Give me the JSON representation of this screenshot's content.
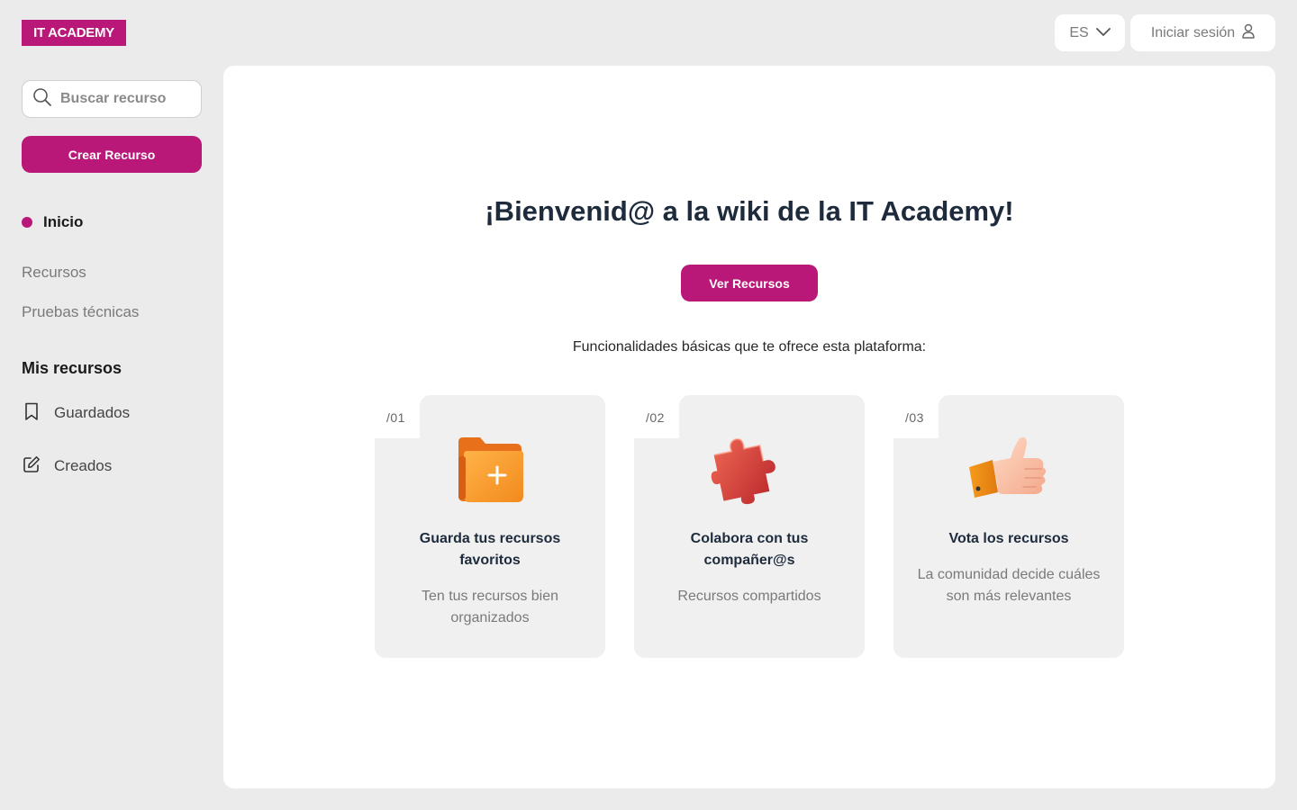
{
  "header": {
    "logo": "IT ACADEMY",
    "language": "ES",
    "login_label": "Iniciar sesión"
  },
  "sidebar": {
    "search_placeholder": "Buscar recurso",
    "create_label": "Crear Recurso",
    "nav": [
      {
        "label": "Inicio",
        "active": true
      },
      {
        "label": "Recursos",
        "active": false
      },
      {
        "label": "Pruebas técnicas",
        "active": false
      }
    ],
    "my_resources_title": "Mis recursos",
    "my_resources": [
      {
        "label": "Guardados",
        "icon": "bookmark-icon"
      },
      {
        "label": "Creados",
        "icon": "edit-icon"
      }
    ]
  },
  "main": {
    "welcome": "¡Bienvenid@ a la wiki de la IT Academy!",
    "cta_label": "Ver Recursos",
    "subtitle": "Funcionalidades básicas que te ofrece esta plataforma:",
    "cards": [
      {
        "number": "/01",
        "icon": "folder-plus-icon",
        "title": "Guarda tus recursos favoritos",
        "description": "Ten tus recursos bien organizados"
      },
      {
        "number": "/02",
        "icon": "puzzle-icon",
        "title": "Colabora con tus compañer@s",
        "description": "Recursos compartidos"
      },
      {
        "number": "/03",
        "icon": "thumbs-up-icon",
        "title": "Vota los recursos",
        "description": "La comunidad decide cuáles son más relevantes"
      }
    ]
  },
  "colors": {
    "brand": "#b91879",
    "background": "#ebebeb",
    "card": "#f0f0f0",
    "heading": "#1e2b3c"
  }
}
